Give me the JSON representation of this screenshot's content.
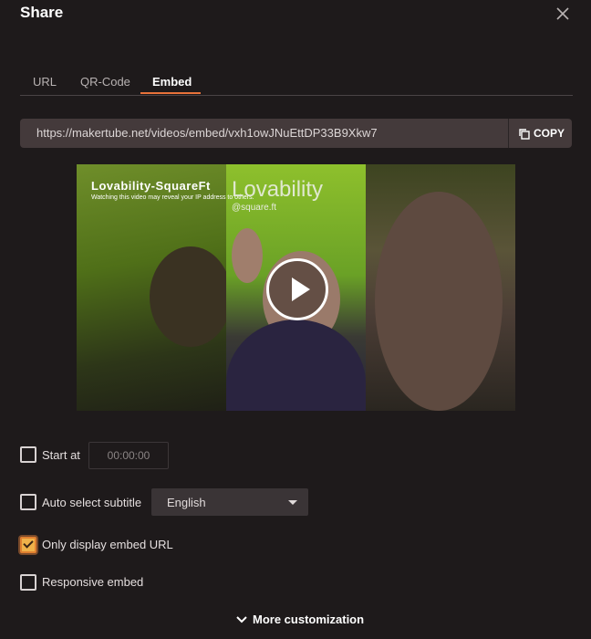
{
  "dialog": {
    "title": "Share"
  },
  "tabs": [
    {
      "label": "URL",
      "active": false
    },
    {
      "label": "QR-Code",
      "active": false
    },
    {
      "label": "Embed",
      "active": true
    }
  ],
  "embed_url": {
    "value": "https://makertube.net/videos/embed/vxh1owJNuEttDP33B9Xkw7",
    "copy_label": "COPY"
  },
  "video": {
    "channel_title": "Lovability-SquareFt",
    "privacy_notice": "Watching this video may reveal your IP address to others.",
    "overlay_title": "Lovability",
    "overlay_handle": "@square.ft"
  },
  "options": {
    "start_at": {
      "label": "Start at",
      "checked": false,
      "placeholder": "00:00:00"
    },
    "auto_subtitle": {
      "label": "Auto select subtitle",
      "checked": false,
      "selected": "English"
    },
    "only_embed_url": {
      "label": "Only display embed URL",
      "checked": true
    },
    "responsive_embed": {
      "label": "Responsive embed",
      "checked": false
    }
  },
  "more_customization": {
    "label": "More customization"
  },
  "colors": {
    "accent": "#e8723a",
    "background": "#1e1a1b",
    "input": "#443a3b"
  }
}
